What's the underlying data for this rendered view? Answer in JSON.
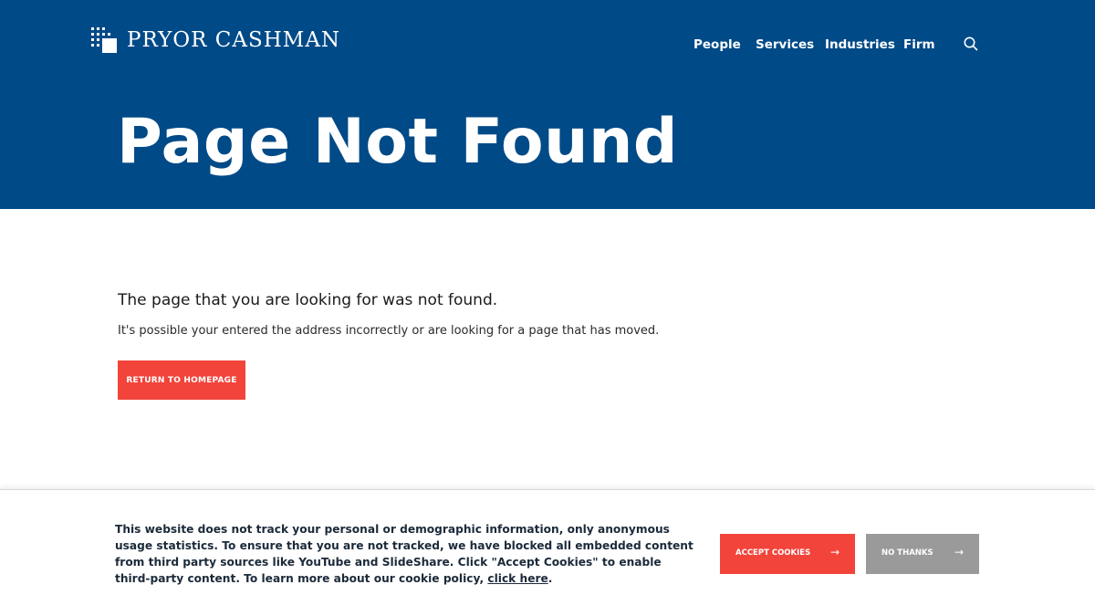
{
  "header": {
    "logo_text": "PRYOR CASHMAN",
    "nav": [
      {
        "label": "People"
      },
      {
        "label": "Services"
      },
      {
        "label": "Industries"
      },
      {
        "label": "Firm"
      }
    ],
    "search_icon": "search-icon"
  },
  "hero": {
    "title": "Page Not Found"
  },
  "content": {
    "heading": "The page that you are looking for was not found.",
    "text": "It's possible your entered the address incorrectly or are looking for a page that has moved.",
    "button_label": "RETURN TO HOMEPAGE"
  },
  "cookie": {
    "text": "This website does not track your personal or demographic information, only anonymous usage statistics. To ensure that you are not tracked, we have blocked all embedded content from third party sources like YouTube and SlideShare. Click \"Accept Cookies\" to enable third-party content. To learn more about our cookie policy,",
    "link_text": "click here",
    "trailing": ".",
    "accept_label": "ACCEPT COOKIES",
    "decline_label": "NO THANKS",
    "arrow_icon": "arrow-right-icon"
  },
  "colors": {
    "brand_blue": "#004a87",
    "accent_red": "#f2443b",
    "secondary_gray": "#9a9a9a"
  }
}
